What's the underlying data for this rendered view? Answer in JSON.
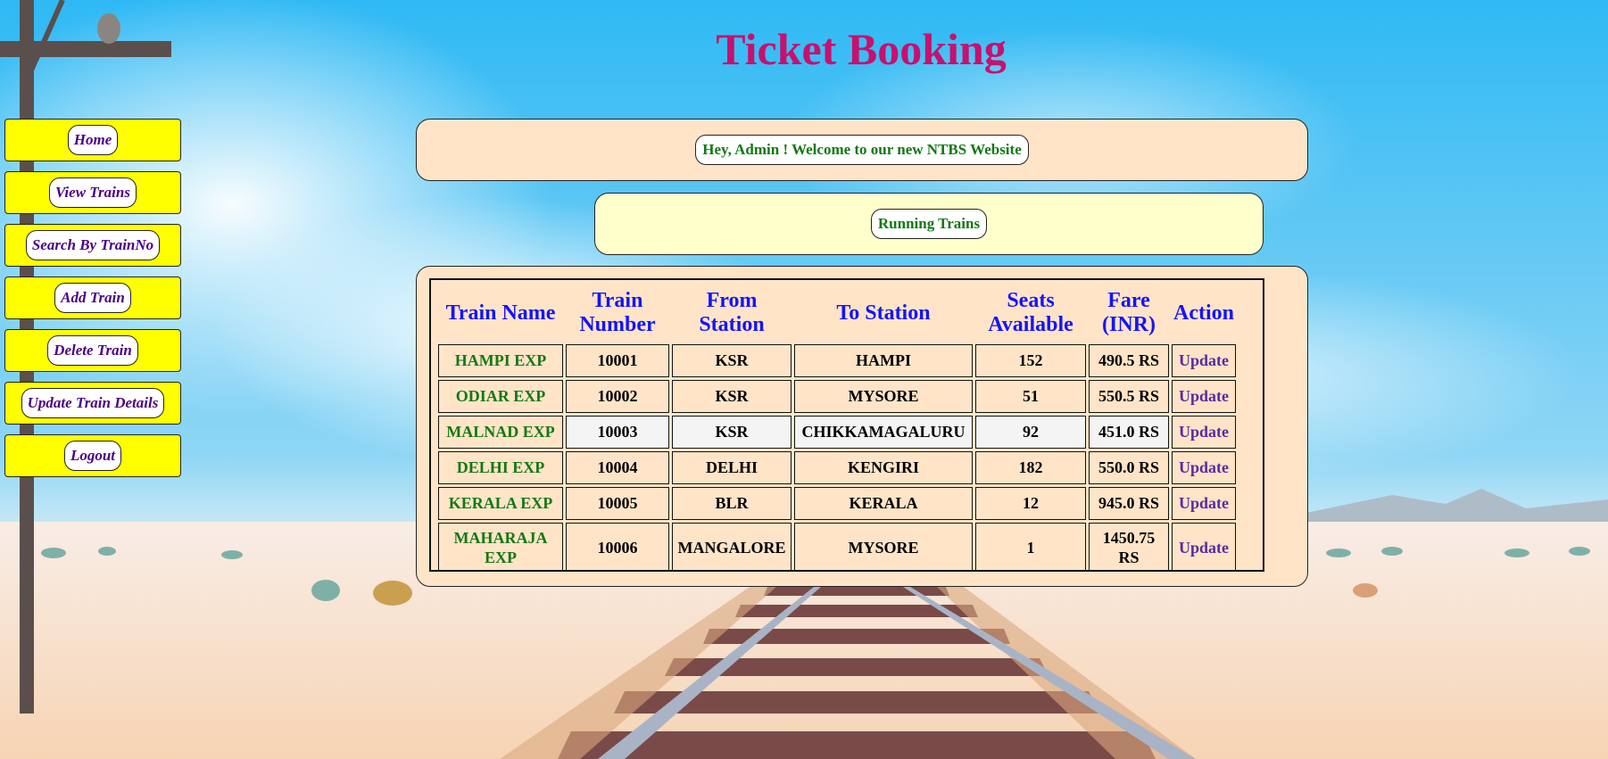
{
  "page": {
    "title": "Ticket Booking"
  },
  "sidebar": {
    "items": [
      {
        "label": "Home"
      },
      {
        "label": "View Trains"
      },
      {
        "label": "Search By TrainNo"
      },
      {
        "label": "Add Train"
      },
      {
        "label": "Delete Train"
      },
      {
        "label": "Update Train Details"
      },
      {
        "label": "Logout"
      }
    ]
  },
  "welcome": {
    "message": "Hey, Admin ! Welcome to our new NTBS Website"
  },
  "running": {
    "label": "Running Trains"
  },
  "table": {
    "headers": {
      "name": "Train Name",
      "number": "Train Number",
      "from": "From Station",
      "to": "To Station",
      "seats": "Seats Available",
      "fare": "Fare (INR)",
      "action": "Action"
    },
    "rows": [
      {
        "name": "HAMPI EXP",
        "number": "10001",
        "from": "KSR",
        "to": "HAMPI",
        "seats": "152",
        "fare": "490.5 RS",
        "action": "Update"
      },
      {
        "name": "ODIAR EXP",
        "number": "10002",
        "from": "KSR",
        "to": "MYSORE",
        "seats": "51",
        "fare": "550.5 RS",
        "action": "Update"
      },
      {
        "name": "MALNAD EXP",
        "number": "10003",
        "from": "KSR",
        "to": "CHIKKAMAGALURU",
        "seats": "92",
        "fare": "451.0 RS",
        "action": "Update"
      },
      {
        "name": "DELHI EXP",
        "number": "10004",
        "from": "DELHI",
        "to": "KENGIRI",
        "seats": "182",
        "fare": "550.0 RS",
        "action": "Update"
      },
      {
        "name": "KERALA EXP",
        "number": "10005",
        "from": "BLR",
        "to": "KERALA",
        "seats": "12",
        "fare": "945.0 RS",
        "action": "Update"
      },
      {
        "name": "MAHARAJA EXP",
        "number": "10006",
        "from": "MANGALORE",
        "to": "MYSORE",
        "seats": "1",
        "fare": "1450.75 RS",
        "action": "Update"
      }
    ]
  },
  "colors": {
    "title": "#c8106e",
    "sidebar_bg": "#ffff00",
    "sidebar_text": "#4b0082",
    "panel_peach": "#ffe4c8",
    "panel_yellow": "#ffffcc",
    "header_blue": "#1414ff",
    "name_green": "#147814",
    "sky": "#33bbf2"
  }
}
